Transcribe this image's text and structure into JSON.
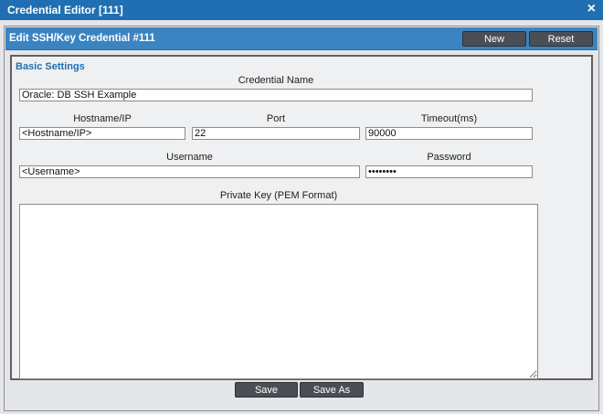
{
  "window": {
    "title": "Credential Editor [111]",
    "close_glyph": "×"
  },
  "header": {
    "title": "Edit SSH/Key Credential #111",
    "new_label": "New",
    "reset_label": "Reset"
  },
  "section": {
    "title": "Basic Settings"
  },
  "fields": {
    "credential_name": {
      "label": "Credential Name",
      "value": "Oracle: DB SSH Example"
    },
    "hostname": {
      "label": "Hostname/IP",
      "value": "<Hostname/IP>"
    },
    "port": {
      "label": "Port",
      "value": "22"
    },
    "timeout": {
      "label": "Timeout(ms)",
      "value": "90000"
    },
    "username": {
      "label": "Username",
      "value": "<Username>"
    },
    "password": {
      "label": "Password",
      "value": "••••••••"
    },
    "private_key": {
      "label": "Private Key (PEM Format)",
      "value": ""
    }
  },
  "footer": {
    "save_label": "Save",
    "save_as_label": "Save As"
  },
  "colors": {
    "title_bar": "#1f6fb2",
    "subheader": "#3a84c2",
    "button": "#4a4f55",
    "section_title": "#1f6fb2"
  }
}
